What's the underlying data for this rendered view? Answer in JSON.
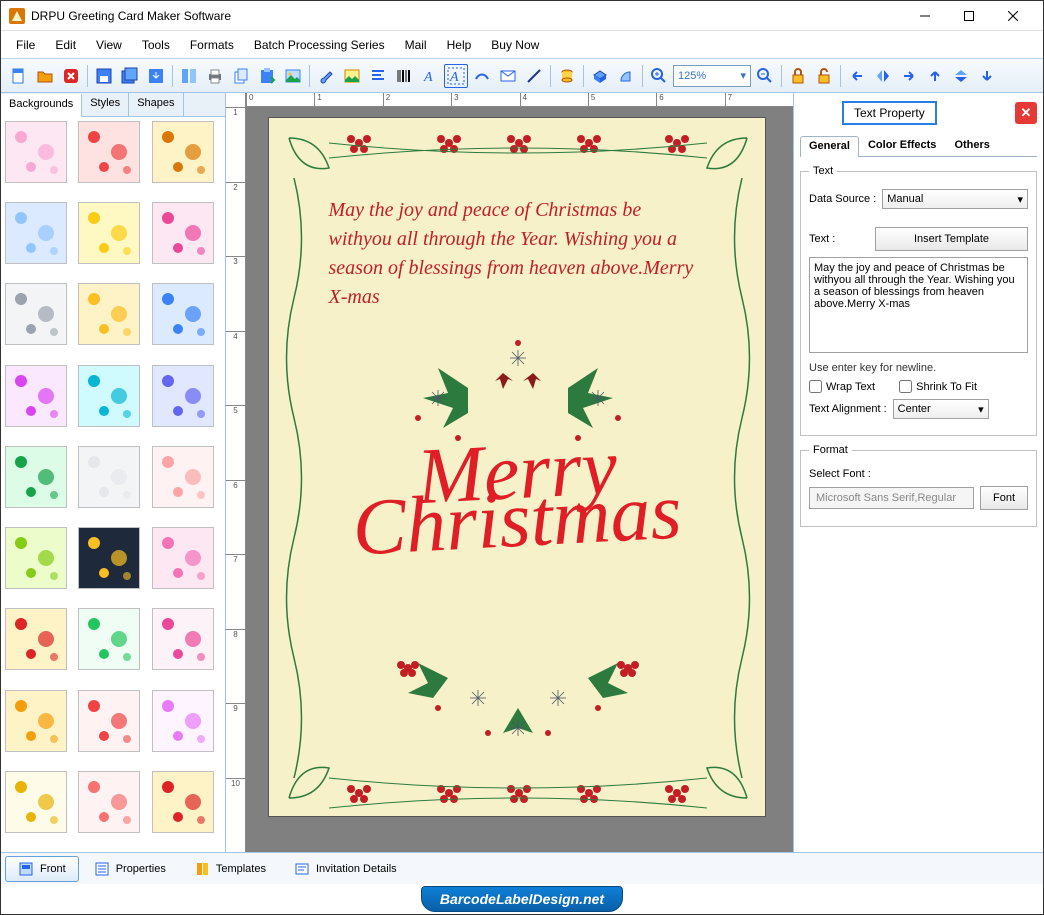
{
  "titlebar": {
    "title": "DRPU Greeting Card Maker Software"
  },
  "menubar": [
    "File",
    "Edit",
    "View",
    "Tools",
    "Formats",
    "Batch Processing Series",
    "Mail",
    "Help",
    "Buy Now"
  ],
  "toolbar": {
    "zoom": "125%",
    "icons": [
      "new",
      "open",
      "delete",
      "save",
      "saveall",
      "export",
      "print",
      "printer",
      "copy",
      "paste",
      "image",
      "brush",
      "picture",
      "align-left",
      "barcode",
      "text-a",
      "text-sel",
      "cursive",
      "mail",
      "line",
      "cylinder",
      "shape3d",
      "shape",
      "zoom-in",
      "zoom-out",
      "lock",
      "unlock",
      "arrow-left",
      "flip-h",
      "arrow-right",
      "arrow-up",
      "flip-v",
      "arrow-down"
    ]
  },
  "leftpanel": {
    "tabs": [
      "Backgrounds",
      "Styles",
      "Shapes"
    ],
    "active": 0,
    "thumbs": 27
  },
  "canvas": {
    "card_message": "May the joy and peace of Christmas be withyou all through the Year. Wishing you a season of blessings from heaven above.Merry X-mas",
    "merry_line1": "Merry",
    "merry_line2": "Christmas",
    "ruler_marks": [
      "0",
      "1",
      "2",
      "3",
      "4",
      "5",
      "6",
      "7"
    ],
    "vruler_marks": [
      "1",
      "2",
      "3",
      "4",
      "5",
      "6",
      "7",
      "8",
      "9",
      "10"
    ]
  },
  "rightpanel": {
    "title": "Text Property",
    "tabs": [
      "General",
      "Color Effects",
      "Others"
    ],
    "active": 0,
    "text_group_label": "Text",
    "data_source_label": "Data Source :",
    "data_source_value": "Manual",
    "text_label": "Text :",
    "insert_template": "Insert Template",
    "text_value": "May the joy and peace of Christmas be withyou all through the Year. Wishing you a season of blessings from heaven above.Merry X-mas",
    "hint": "Use enter key for newline.",
    "wrap_label": "Wrap Text",
    "shrink_label": "Shrink To Fit",
    "align_label": "Text Alignment :",
    "align_value": "Center",
    "format_label": "Format",
    "select_font_label": "Select Font :",
    "font_value": "Microsoft Sans Serif,Regular",
    "font_button": "Font"
  },
  "bottombar": {
    "tabs": [
      "Front",
      "Properties",
      "Templates",
      "Invitation Details"
    ],
    "active": 0
  },
  "footer": {
    "text": "BarcodeLabelDesign.net"
  }
}
